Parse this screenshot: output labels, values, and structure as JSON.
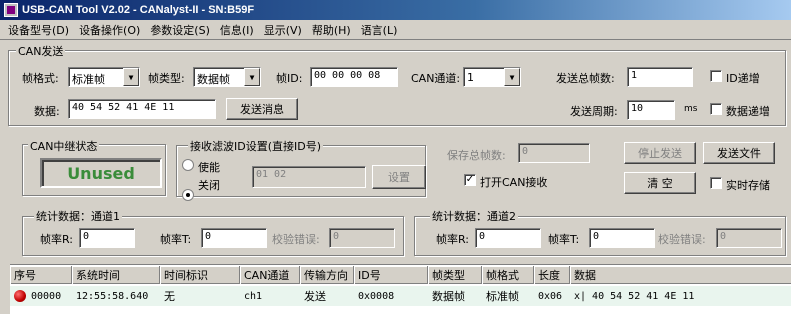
{
  "window": {
    "title": "USB-CAN Tool V2.02 - CANalyst-II - SN:B59F"
  },
  "menu": [
    "设备型号(D)",
    "设备操作(O)",
    "参数设定(S)",
    "信息(I)",
    "显示(V)",
    "帮助(H)",
    "语言(L)"
  ],
  "can_send": {
    "group_title": "CAN发送",
    "frame_format_label": "帧格式:",
    "frame_format_value": "标准帧",
    "frame_type_label": "帧类型:",
    "frame_type_value": "数据帧",
    "frame_id_label": "帧ID:",
    "frame_id_value": "00 00 00 08",
    "channel_label": "CAN通道:",
    "channel_value": "1",
    "total_frames_label": "发送总帧数:",
    "total_frames_value": "1",
    "id_increment_label": "ID递增",
    "data_label": "数据:",
    "data_value": "40 54 52 41 4E 11",
    "send_button": "发送消息",
    "period_label": "发送周期:",
    "period_value": "10",
    "period_unit": "ms",
    "data_increment_label": "数据递增"
  },
  "relay": {
    "group_title": "CAN中继状态",
    "status": "Unused"
  },
  "filter": {
    "group_title": "接收滤波ID设置(直接ID号)",
    "enable_label": "使能",
    "disable_label": "关闭",
    "ids_value": "01 02",
    "set_button": "设置"
  },
  "right_panel": {
    "saved_frames_label": "保存总帧数:",
    "saved_frames_value": "0",
    "stop_send_button": "停止发送",
    "send_file_button": "发送文件",
    "open_receive_label": "打开CAN接收",
    "clear_button": "清 空",
    "realtime_save_label": "实时存储"
  },
  "stats1": {
    "group_title": "统计数据：通道1",
    "frame_rate_r_label": "帧率R:",
    "frame_rate_r_value": "0",
    "frame_rate_t_label": "帧率T:",
    "frame_rate_t_value": "0",
    "check_error_label": "校验错误:",
    "check_error_value": "0"
  },
  "stats2": {
    "group_title": "统计数据：通道2",
    "frame_rate_r_label": "帧率R:",
    "frame_rate_r_value": "0",
    "frame_rate_t_label": "帧率T:",
    "frame_rate_t_value": "0",
    "check_error_label": "校验错误:",
    "check_error_value": "0"
  },
  "table": {
    "columns": [
      "序号",
      "系统时间",
      "时间标识",
      "CAN通道",
      "传输方向",
      "ID号",
      "帧类型",
      "帧格式",
      "长度",
      "数据"
    ],
    "rows": [
      [
        "00000",
        "12:55:58.640",
        "无",
        "ch1",
        "发送",
        "0x0008",
        "数据帧",
        "标准帧",
        "0x06",
        "x| 40 54 52 41 4E 11"
      ]
    ]
  },
  "colors": {
    "status_green": "#3a8c3a",
    "row_indicator": "#c00000",
    "title_bar": "#0a246a"
  }
}
